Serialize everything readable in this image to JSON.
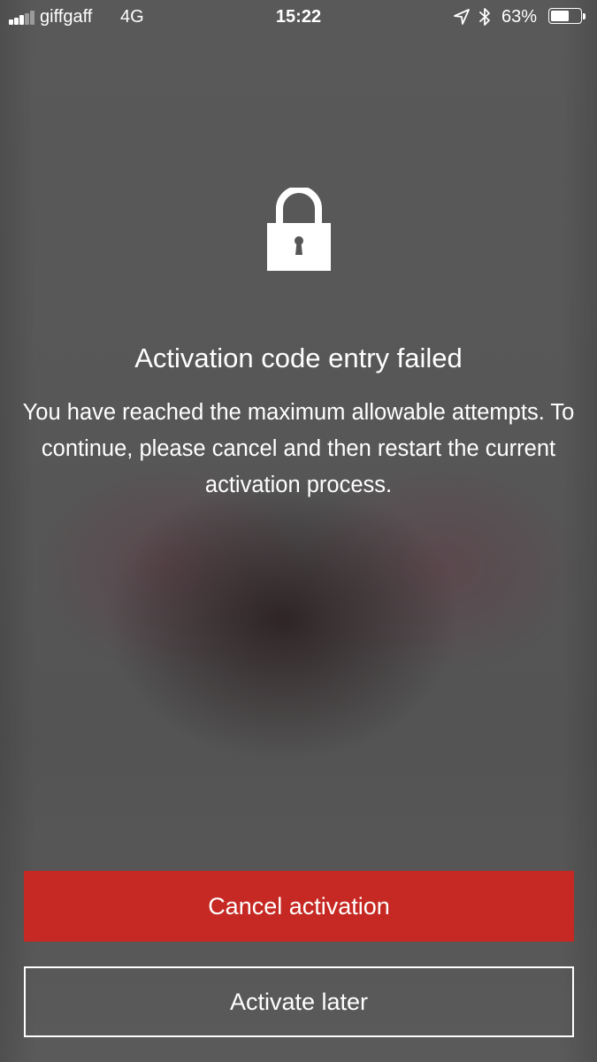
{
  "status_bar": {
    "carrier": "giffgaff",
    "network": "4G",
    "time": "15:22",
    "battery_percent": "63%",
    "battery_level": 0.63,
    "signal_bars_filled": 3,
    "signal_bars_total": 5,
    "icons": [
      "signal-icon",
      "location-icon",
      "bluetooth-icon",
      "battery-icon"
    ]
  },
  "main": {
    "icon": "lock-icon",
    "title": "Activation code entry failed",
    "message": "You have reached the maximum allowable attempts. To continue, please cancel and then restart the current activation process."
  },
  "actions": {
    "cancel_label": "Cancel activation",
    "later_label": "Activate later"
  },
  "colors": {
    "accent": "#c62823",
    "background": "#565656",
    "text": "#ffffff"
  }
}
